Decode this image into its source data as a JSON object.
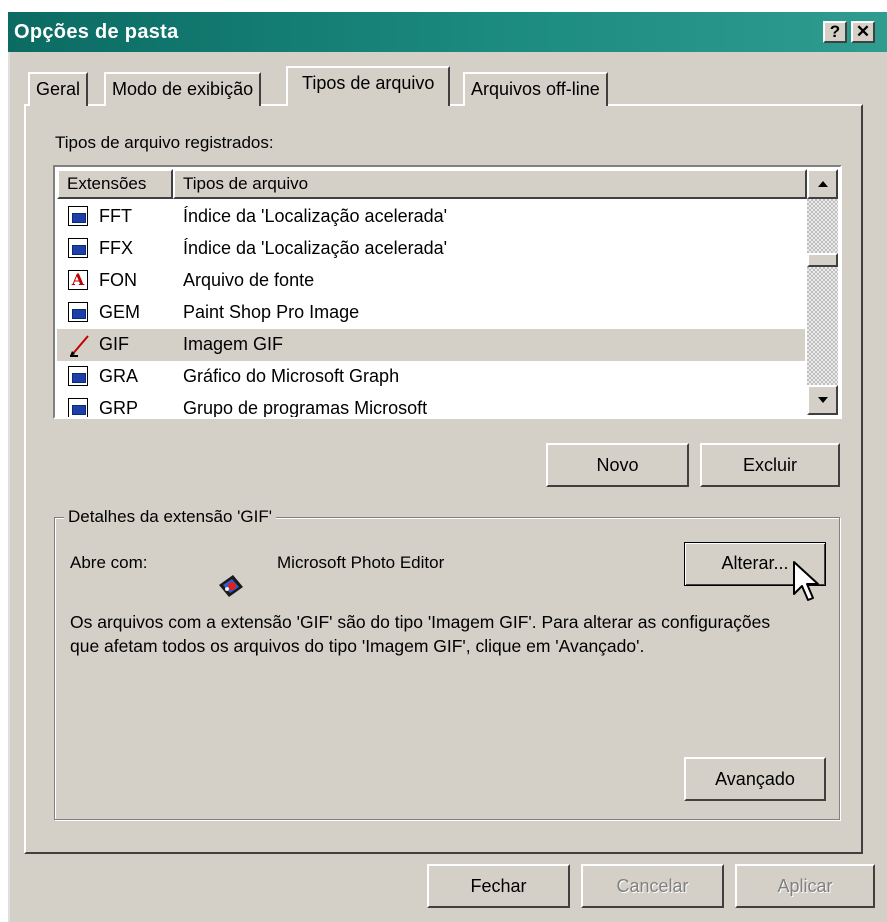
{
  "window": {
    "title": "Opções de pasta",
    "help_button": "?",
    "close_button": "✕"
  },
  "tabs": [
    {
      "label": "Geral"
    },
    {
      "label": "Modo de exibição"
    },
    {
      "label": "Tipos de arquivo"
    },
    {
      "label": "Arquivos off-line"
    }
  ],
  "active_tab": "Tipos de arquivo",
  "registered": {
    "label": "Tipos de arquivo registrados:",
    "columns": [
      "Extensões",
      "Tipos de arquivo"
    ],
    "rows": [
      {
        "ext": "FFT",
        "type": "Índice da 'Localização acelerada'",
        "icon": "index-file-icon"
      },
      {
        "ext": "FFX",
        "type": "Índice da 'Localização acelerada'",
        "icon": "index-file-icon"
      },
      {
        "ext": "FON",
        "type": "Arquivo de fonte",
        "icon": "font-file-icon"
      },
      {
        "ext": "GEM",
        "type": "Paint Shop Pro Image",
        "icon": "image-file-icon"
      },
      {
        "ext": "GIF",
        "type": "Imagem GIF",
        "icon": "gif-file-icon"
      },
      {
        "ext": "GRA",
        "type": "Gráfico do Microsoft Graph",
        "icon": "graph-file-icon"
      },
      {
        "ext": "GRP",
        "type": "Grupo de programas Microsoft",
        "icon": "program-group-icon"
      }
    ],
    "selected_ext": "GIF"
  },
  "actions": {
    "new": "Novo",
    "delete": "Excluir"
  },
  "details": {
    "title": "Detalhes da extensão 'GIF'",
    "opens_with_label": "Abre com:",
    "opens_with_app": "Microsoft Photo Editor",
    "change_button": "Alterar...",
    "description": "Os arquivos com a extensão 'GIF' são do tipo 'Imagem GIF'. Para alterar as configurações que afetam todos os arquivos do tipo 'Imagem GIF', clique em 'Avançado'.",
    "advanced_button": "Avançado"
  },
  "footer": {
    "close": "Fechar",
    "cancel": "Cancelar",
    "apply": "Aplicar"
  }
}
